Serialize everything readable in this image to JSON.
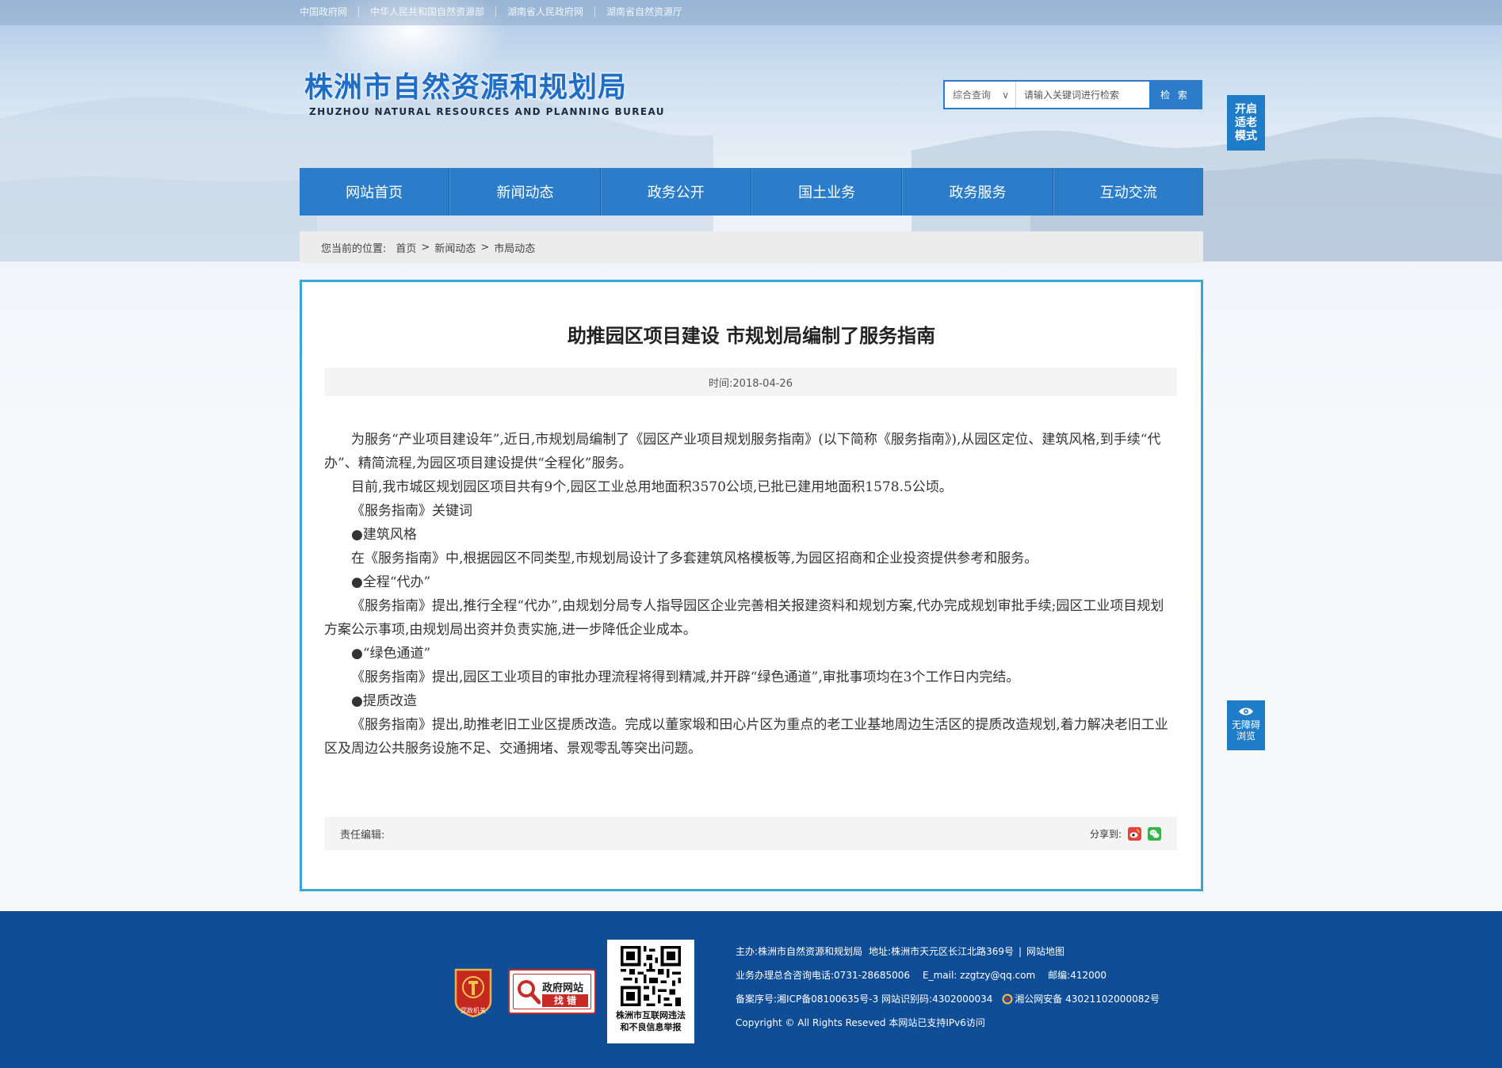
{
  "top_links": [
    "中国政府网",
    "中华人民共和国自然资源部",
    "湖南省人民政府网",
    "湖南省自然资源厅"
  ],
  "logo": {
    "cn": "株洲市自然资源和规划局",
    "en": "ZHUZHOU NATURAL RESOURCES AND PLANNING BUREAU"
  },
  "search": {
    "scope": "综合查询",
    "scope_arrow": "∨",
    "placeholder": "请输入关键词进行检索",
    "button": "检 索"
  },
  "elder_mode": [
    "开启",
    "适老",
    "模式"
  ],
  "nav": [
    "网站首页",
    "新闻动态",
    "政务公开",
    "国土业务",
    "政务服务",
    "互动交流"
  ],
  "breadcrumb": {
    "prefix": "您当前的位置:",
    "items": [
      "首页",
      "新闻动态",
      "市局动态"
    ],
    "sep": ">"
  },
  "article": {
    "title": "助推园区项目建设 市规划局编制了服务指南",
    "meta": "时间:2018-04-26",
    "paragraphs": [
      "为服务“产业项目建设年”,近日,市规划局编制了《园区产业项目规划服务指南》(以下简称《服务指南》),从园区定位、建筑风格,到手续“代办”、精简流程,为园区项目建设提供“全程化”服务。",
      "目前,我市城区规划园区项目共有9个,园区工业总用地面积3570公顷,已批已建用地面积1578.5公顷。",
      "《服务指南》关键词",
      "●建筑风格",
      "在《服务指南》中,根据园区不同类型,市规划局设计了多套建筑风格模板等,为园区招商和企业投资提供参考和服务。",
      "●全程“代办”",
      "《服务指南》提出,推行全程“代办”,由规划分局专人指导园区企业完善相关报建资料和规划方案,代办完成规划审批手续;园区工业项目规划方案公示事项,由规划局出资并负责实施,进一步降低企业成本。",
      "●“绿色通道”",
      "《服务指南》提出,园区工业项目的审批办理流程将得到精减,并开辟“绿色通道”,审批事项均在3个工作日内完结。",
      "●提质改造",
      "《服务指南》提出,助推老旧工业区提质改造。完成以董家塅和田心片区为重点的老工业基地周边生活区的提质改造规划,着力解决老旧工业区及周边公共服务设施不足、交通拥堵、景观零乱等突出问题。"
    ],
    "editor_label": "责任编辑:",
    "share_label": "分享到:"
  },
  "a11y_badge": [
    "无障碍",
    "浏览"
  ],
  "footer": {
    "party_label": "党政机关",
    "gov_find": [
      "政府网站",
      "找 错"
    ],
    "qr_caption": [
      "株洲市互联网违法",
      "和不良信息举报"
    ],
    "sponsor": "主办:株洲市自然资源和规划局",
    "address": "地址:株洲市天元区长江北路369号",
    "sitemap": "网站地图",
    "phone": "业务办理总合咨询电话:0731-28685006",
    "email": "E_mail: zzgtzy@qq.com",
    "postcode": "邮编:412000",
    "icp": "备案序号:湘ICP备08100635号-3 网站识别码:4302000034",
    "police": "湘公网安备 43021102000082号",
    "copyright": "Copyright © All Rights Reseved 本网站已支持IPv6访问"
  },
  "colors": {
    "primary": "#2b7cc9",
    "border_accent": "#3aa6d8",
    "footer_bg": "#0f4d96",
    "badge": "#1e7cc8"
  }
}
